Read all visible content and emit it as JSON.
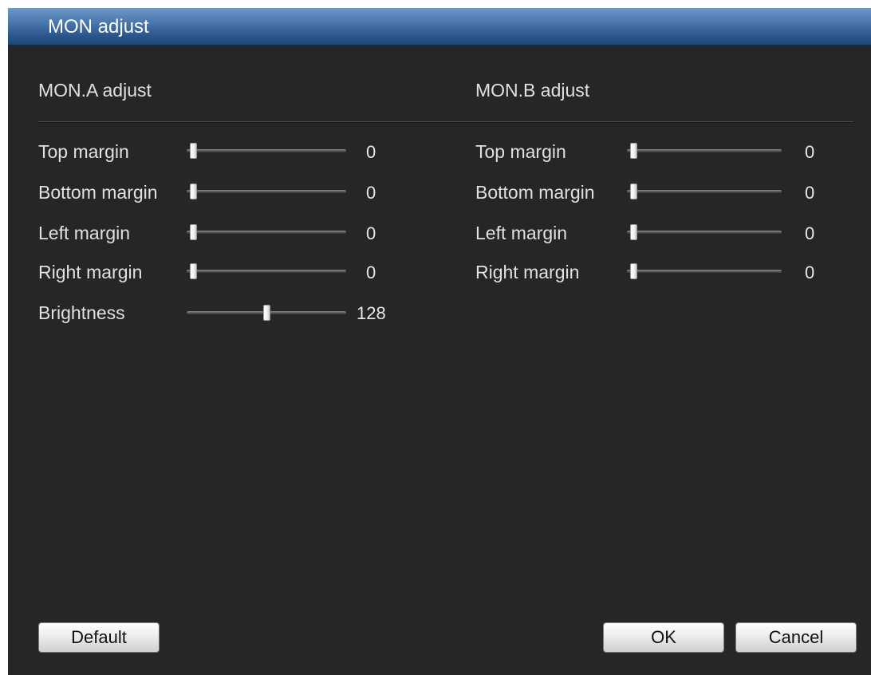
{
  "dialog": {
    "title": "MON adjust"
  },
  "mon_a": {
    "heading": "MON.A adjust",
    "rows": [
      {
        "label": "Top margin",
        "value": "0",
        "level": 0
      },
      {
        "label": "Bottom margin",
        "value": "0",
        "level": 0
      },
      {
        "label": "Left margin",
        "value": "0",
        "level": 0
      },
      {
        "label": "Right margin",
        "value": "0",
        "level": 0
      },
      {
        "label": "Brightness",
        "value": "128",
        "level": 0.5
      }
    ]
  },
  "mon_b": {
    "heading": "MON.B adjust",
    "rows": [
      {
        "label": "Top margin",
        "value": "0",
        "level": 0
      },
      {
        "label": "Bottom margin",
        "value": "0",
        "level": 0
      },
      {
        "label": "Left margin",
        "value": "0",
        "level": 0
      },
      {
        "label": "Right margin",
        "value": "0",
        "level": 0
      }
    ]
  },
  "buttons": {
    "default_label": "Default",
    "ok_label": "OK",
    "cancel_label": "Cancel"
  },
  "colors": {
    "title_bar": "#4a77ad",
    "dialog_background": "#262626",
    "text": "#e0e0e0"
  }
}
